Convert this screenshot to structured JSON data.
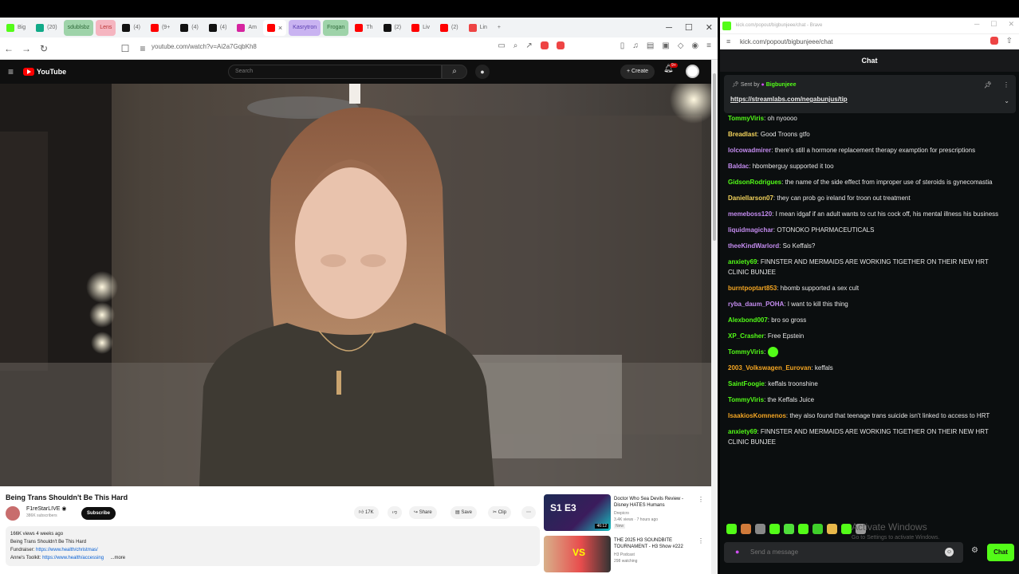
{
  "browser_left": {
    "tabs": [
      {
        "label": "Big",
        "icon": "kick-icon",
        "style": ""
      },
      {
        "label": "(20)",
        "icon": "app-icon",
        "style": ""
      },
      {
        "label": "sdublsbz",
        "icon": "",
        "style": "green"
      },
      {
        "label": "Lens",
        "icon": "",
        "style": "pink"
      },
      {
        "label": "(4)",
        "icon": "x-icon",
        "style": ""
      },
      {
        "label": "(9+",
        "icon": "youtube-icon",
        "style": ""
      },
      {
        "label": "(4)",
        "icon": "x-icon",
        "style": ""
      },
      {
        "label": "(4)",
        "icon": "x-icon",
        "style": ""
      },
      {
        "label": "Am",
        "icon": "instagram-icon",
        "style": ""
      },
      {
        "label": "×",
        "icon": "youtube-icon",
        "style": "active"
      },
      {
        "label": "Kasrytron",
        "icon": "",
        "style": "purple"
      },
      {
        "label": "Frogan",
        "icon": "",
        "style": "green"
      },
      {
        "label": "Th",
        "icon": "youtube-icon",
        "style": ""
      },
      {
        "label": "(2)",
        "icon": "x-icon",
        "style": ""
      },
      {
        "label": "Liv",
        "icon": "youtube-icon",
        "style": ""
      },
      {
        "label": "(2)",
        "icon": "youtube-icon",
        "style": ""
      },
      {
        "label": "Lin",
        "icon": "google-icon",
        "style": ""
      }
    ],
    "url": "youtube.com/watch?v=Ai2a7GqbKh8"
  },
  "youtube": {
    "logo": "YouTube",
    "search_placeholder": "Search",
    "create_label": "Create",
    "notif_count": "9+",
    "video_title": "Being Trans Shouldn't Be This Hard",
    "channel_name": "F1reStarLIVE",
    "channel_subs": "386K subscribers",
    "subscribe_label": "Subscribe",
    "likes": "17K",
    "share_label": "Share",
    "save_label": "Save",
    "clip_label": "Clip",
    "desc_line1": "166K views  4 weeks ago",
    "desc_line2": "Being Trans Shouldn't Be This Hard",
    "desc_line3_label": "Fundraiser:",
    "desc_line3_link": "https://www.health/christmas/",
    "desc_line4_label": "Anne's Toolkit:",
    "desc_line4_link": "https://www.health/accessing",
    "desc_more": "...more",
    "recommended": [
      {
        "title": "Doctor Who Sea Devils Review - Disney HATES Humans",
        "channel": "Drepicro",
        "meta": "3.4K views · 7 hours ago",
        "badge": "New",
        "thumb_text": "S1 E3",
        "duration": "46:12"
      },
      {
        "title": "THE 2025 H3 SOUNDBITE TOURNAMENT - H3 Show #222",
        "channel": "H3 Podcast",
        "meta": "298 watching",
        "badge": "",
        "thumb_text": "VS",
        "duration": ""
      }
    ]
  },
  "browser_right": {
    "title": "kick.com/popout/bigbunjeee/chat - Brave",
    "url": "kick.com/popout/bigbunjeee/chat",
    "chat_header": "Chat",
    "pinned_sent_by": "Sent by",
    "pinned_user": "Bigbunjeee",
    "pinned_link": "https://streamlabs.com/negabunjus/tip",
    "messages": [
      {
        "user": "TommyViris",
        "color": "#53fc18",
        "text": "oh nyoooo"
      },
      {
        "user": "Breadlast",
        "color": "#f3d35c",
        "text": "Good Troons gtfo"
      },
      {
        "user": "lolcowadmirer",
        "color": "#c48cf0",
        "text": "there's still a hormone replacement therapy examption for prescriptions"
      },
      {
        "user": "Baldac",
        "color": "#c48cf0",
        "text": "hbomberguy supported it too"
      },
      {
        "user": "GidsonRodrigues",
        "color": "#53fc18",
        "text": "the name of the side effect from improper use of steroids is gynecomastia"
      },
      {
        "user": "Daniellarson07",
        "color": "#f3d35c",
        "text": "they can prob go ireland for troon out treatment"
      },
      {
        "user": "memeboss120",
        "color": "#c48cf0",
        "text": "I mean idgaf if an adult wants to cut his cock off, his mental illness his business"
      },
      {
        "user": "liquidmagichar",
        "color": "#c48cf0",
        "text": "OTONOKO PHARMACEUTICALS"
      },
      {
        "user": "theeKindWarlord",
        "color": "#c48cf0",
        "text": "So Keffals?"
      },
      {
        "user": "anxiety69",
        "color": "#53fc18",
        "text": "FINNSTER AND MERMAIDS ARE WORKING TIGETHER ON THEIR NEW HRT CLINIC BUNJEE"
      },
      {
        "user": "burntpoptart853",
        "color": "#f5a623",
        "text": "hbomb supported a sex cult"
      },
      {
        "user": "ryba_daum_POHA",
        "color": "#c48cf0",
        "text": "I want to kill this thing"
      },
      {
        "user": "Alexbond007",
        "color": "#53fc18",
        "text": "bro so gross"
      },
      {
        "user": "XP_Crasher",
        "color": "#53fc18",
        "text": "Free Epstein"
      },
      {
        "user": "TommyViris",
        "color": "#53fc18",
        "text": ""
      },
      {
        "user": "2003_Volkswagen_Eurovan",
        "color": "#f5a623",
        "text": "keffals"
      },
      {
        "user": "SaintFoogie",
        "color": "#53fc18",
        "text": "keffals troonshine"
      },
      {
        "user": "TommyViris",
        "color": "#53fc18",
        "text": "the Keffals Juice"
      },
      {
        "user": "IsaakiosKomnenos",
        "color": "#f5a623",
        "text": "they also found that teenage trans suicide isn't linked to access to HRT"
      },
      {
        "user": "anxiety69",
        "color": "#53fc18",
        "text": "FINNSTER AND MERMAIDS ARE WORKING TIGETHER ON THEIR NEW HRT CLINIC BUNJEE"
      }
    ],
    "watermark_title": "Activate Windows",
    "watermark_sub": "Go to Settings to activate Windows.",
    "input_placeholder": "Send a message",
    "chat_button": "Chat"
  }
}
